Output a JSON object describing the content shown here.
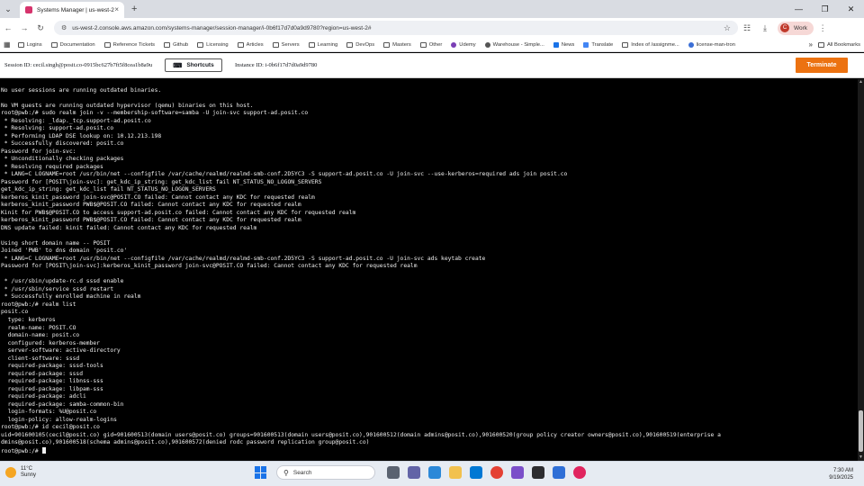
{
  "browser": {
    "tab_title": "Systems Manager | us-west-2",
    "url": "us-west-2.console.aws.amazon.com/systems-manager/session-manager/i-0b6f17d7d0a9d9780?region=us-west-2#",
    "profile_label": "Work",
    "profile_initial": "C",
    "bookmarks": [
      "Logins",
      "Documentation",
      "Reference Tickets",
      "Github",
      "Licensing",
      "Articles",
      "Servers",
      "Learning",
      "DevOps",
      "Masters",
      "Other",
      "Udemy",
      "Warehouse - Simple...",
      "News",
      "Translate",
      "Index of /assignme...",
      "license-man-tron"
    ],
    "all_bookmarks_label": "All Bookmarks"
  },
  "session": {
    "session_id": "Session ID: cecil.singh@posit.co-0915bc627b7ft5f8cea1b8a9u",
    "shortcuts_label": "Shortcuts",
    "instance_id": "Instance ID: i-0b6f17d7d0a9d9780",
    "terminate_label": "Terminate"
  },
  "terminal": {
    "lines": [
      "",
      "No user sessions are running outdated binaries.",
      "",
      "No VM guests are running outdated hypervisor (qemu) binaries on this host.",
      "root@pwb:/# sudo realm join -v --membership-software=samba -U join-svc support-ad.posit.co",
      " * Resolving: _ldap._tcp.support-ad.posit.co",
      " * Resolving: support-ad.posit.co",
      " * Performing LDAP DSE lookup on: 10.12.213.198",
      " * Successfully discovered: posit.co",
      "Password for join-svc:",
      " * Unconditionally checking packages",
      " * Resolving required packages",
      " * LANG=C LOGNAME=root /usr/bin/net --configfile /var/cache/realmd/realmd-smb-conf.2D5YC3 -S support-ad.posit.co -U join-svc --use-kerberos=required ads join posit.co",
      "Password for [POSIT\\join-svc]: get_kdc_ip_string: get_kdc_list fail NT_STATUS_NO_LOGON_SERVERS",
      "get_kdc_ip_string: get_kdc_list fail NT_STATUS_NO_LOGON_SERVERS",
      "kerberos_kinit_password join-svc@POSIT.CO failed: Cannot contact any KDC for requested realm",
      "kerberos_kinit_password PWB$@POSIT.CO failed: Cannot contact any KDC for requested realm",
      "Kinit for PWB$@POSIT.CO to access support-ad.posit.co failed: Cannot contact any KDC for requested realm",
      "kerberos_kinit_password PWB$@POSIT.CO failed: Cannot contact any KDC for requested realm",
      "DNS update failed: kinit failed: Cannot contact any KDC for requested realm",
      "",
      "Using short domain name -- POSIT",
      "Joined 'PWB' to dns domain 'posit.co'",
      " * LANG=C LOGNAME=root /usr/bin/net --configfile /var/cache/realmd/realmd-smb-conf.2D5YC3 -S support-ad.posit.co -U join-svc ads keytab create",
      "Password for [POSIT\\join-svc]:kerberos_kinit_password join-svc@POSIT.CO failed: Cannot contact any KDC for requested realm",
      "",
      " * /usr/sbin/update-rc.d sssd enable",
      " * /usr/sbin/service sssd restart",
      " * Successfully enrolled machine in realm",
      "root@pwb:/# realm list",
      "posit.co",
      "  type: kerberos",
      "  realm-name: POSIT.CO",
      "  domain-name: posit.co",
      "  configured: kerberos-member",
      "  server-software: active-directory",
      "  client-software: sssd",
      "  required-package: sssd-tools",
      "  required-package: sssd",
      "  required-package: libnss-sss",
      "  required-package: libpam-sss",
      "  required-package: adcli",
      "  required-package: samba-common-bin",
      "  login-formats: %U@posit.co",
      "  login-policy: allow-realm-logins",
      "root@pwb:/# id cecil@posit.co",
      "uid=901600105(cecil@posit.co) gid=901600513(domain users@posit.co) groups=901600513(domain users@posit.co),901600512(domain admins@posit.co),901600520(group policy creator owners@posit.co),901600519(enterprise a",
      "dmins@posit.co),901600518(schema admins@posit.co),901600572(denied rodc password replication group@posit.co)"
    ],
    "prompt": "root@pwb:/# "
  },
  "taskbar": {
    "temperature": "11°C",
    "weather": "Sunny",
    "search_placeholder": "Search",
    "time": "7:30 AM",
    "date": "9/19/2025"
  }
}
